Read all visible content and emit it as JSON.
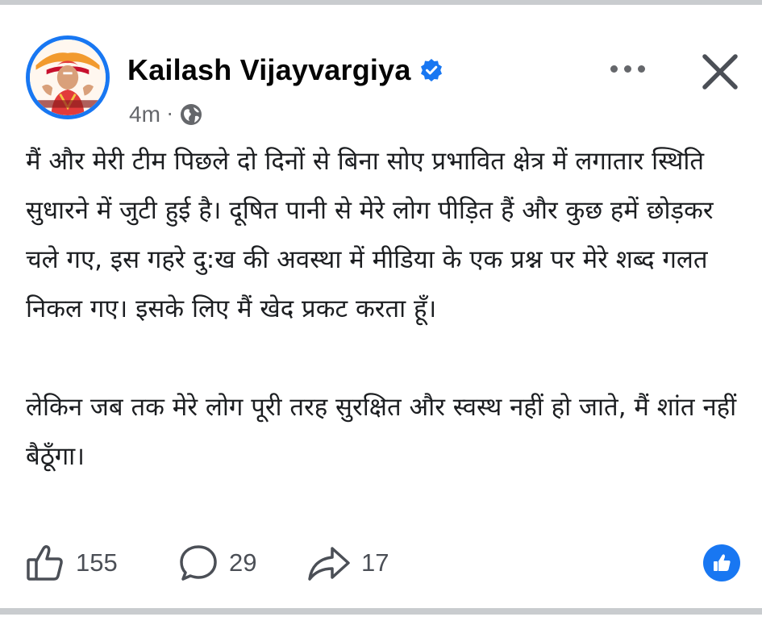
{
  "post": {
    "author": "Kailash Vijayvargiya",
    "verified": true,
    "timestamp": "4m",
    "separator": "·",
    "audience_icon": "globe-icon",
    "paragraphs": [
      "मैं और मेरी टीम पिछले दो दिनों से बिना सोए प्रभावित क्षेत्र में लगातार स्थिति सुधारने में जुटी हुई है। दूषित पानी से मेरे लोग पीड़ित हैं और कुछ हमें छोड़कर चले गए, इस गहरे दु:ख की अवस्था में मीडिया के एक प्रश्न पर मेरे शब्द गलत निकल गए। इसके लिए मैं खेद प्रकट करता हूँ।",
      "लेकिन जब तक मेरे लोग पूरी तरह सुरक्षित और स्वस्थ नहीं हो जाते, मैं शांत नहीं बैठूँगा।"
    ]
  },
  "actions": {
    "likes": "155",
    "comments": "29",
    "shares": "17"
  },
  "icons": {
    "more": "more-icon",
    "close": "close-icon",
    "like": "thumbs-up-icon",
    "comment": "comment-icon",
    "share": "share-icon",
    "reaction": "like-reaction-icon",
    "verified": "verified-badge-icon"
  },
  "colors": {
    "brand": "#1877f2",
    "text": "#1c1e21",
    "muted": "#65676b",
    "border": "#c9cccf"
  }
}
